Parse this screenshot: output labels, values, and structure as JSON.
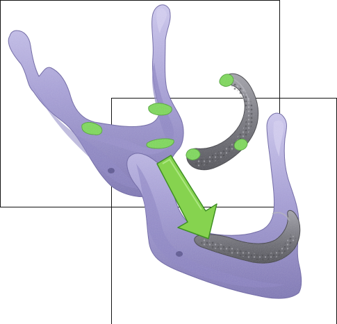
{
  "figure": {
    "colors": {
      "background": "#ffffff",
      "frame_line": "#111111",
      "bone_fill": "#a9a2d9",
      "bone_shadow": "#7f77b6",
      "bone_highlight": "#cfcaf0",
      "teeth_fill": "#77777f",
      "teeth_shadow": "#4e4e56",
      "teeth_highlight": "#a5a5ad",
      "green_marker": "#7ed957",
      "green_marker_dark": "#4fa72e",
      "arrow_fill": "#86d34f",
      "arrow_stroke": "#3f8f24"
    },
    "icons": {
      "arrow": "down-right-arrow-icon"
    }
  }
}
